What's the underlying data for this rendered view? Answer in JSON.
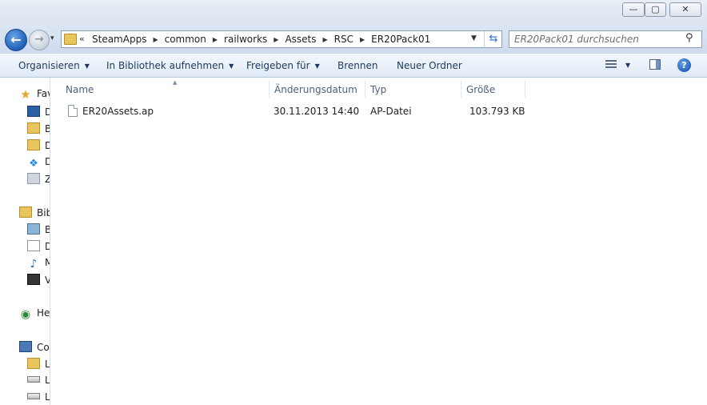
{
  "window": {
    "minimize_label": "—",
    "maximize_label": "▢",
    "close_label": "✕"
  },
  "nav": {
    "back_label": "←",
    "forward_label": "→",
    "recent_label": "▾"
  },
  "address": {
    "overflow_label": "«",
    "breadcrumbs": [
      "SteamApps",
      "common",
      "railworks",
      "Assets",
      "RSC",
      "ER20Pack01"
    ]
  },
  "search": {
    "placeholder": "ER20Pack01 durchsuchen",
    "value": ""
  },
  "toolbar": {
    "organize": "Organisieren",
    "include_library": "In Bibliothek aufnehmen",
    "share": "Freigeben für",
    "burn": "Brennen",
    "new_folder": "Neuer Ordner",
    "help": "?"
  },
  "sidebar": {
    "favorites": {
      "label": "Fav",
      "icon": "star-icon"
    },
    "favorites_items": [
      {
        "label": "D",
        "icon": "desktop-icon"
      },
      {
        "label": "B",
        "icon": "folder-icon"
      },
      {
        "label": "D",
        "icon": "downloads-icon"
      },
      {
        "label": "D",
        "icon": "dropbox-icon"
      },
      {
        "label": "Z",
        "icon": "recent-places-icon"
      }
    ],
    "libraries": {
      "label": "Bib",
      "icon": "library-icon"
    },
    "libraries_items": [
      {
        "label": "B",
        "icon": "pictures-icon"
      },
      {
        "label": "D",
        "icon": "documents-icon"
      },
      {
        "label": "M",
        "icon": "music-icon"
      },
      {
        "label": "V",
        "icon": "videos-icon"
      }
    ],
    "homegroup": {
      "label": "He",
      "icon": "homegroup-icon"
    },
    "computer": {
      "label": "Co",
      "icon": "computer-icon"
    },
    "computer_items": [
      {
        "label": "L",
        "icon": "system-drive-icon"
      },
      {
        "label": "L",
        "icon": "drive-icon"
      },
      {
        "label": "L",
        "icon": "drive-icon"
      }
    ]
  },
  "columns": {
    "name": "Name",
    "date": "Änderungsdatum",
    "type": "Typ",
    "size": "Größe"
  },
  "files": [
    {
      "name": "ER20Assets.ap",
      "date": "30.11.2013 14:40",
      "type": "AP-Datei",
      "size": "103.793 KB"
    }
  ]
}
